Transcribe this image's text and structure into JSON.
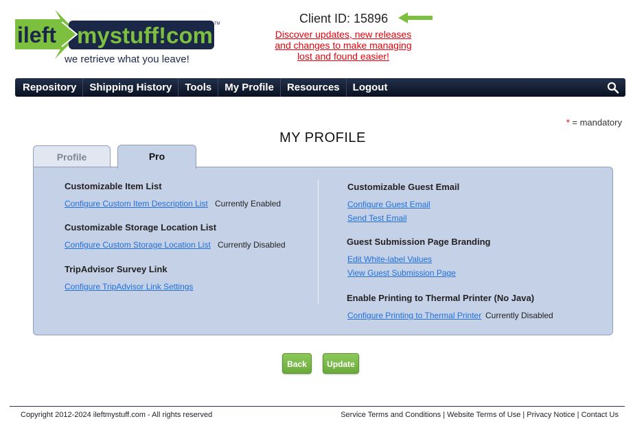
{
  "brand": {
    "name_part1": "ileft",
    "name_part2": "mystuff!com",
    "tagline": "we retrieve what you leave!",
    "tm": "TM",
    "colors": {
      "green": "#7dbf3f",
      "navy": "#1b2747",
      "accent_red": "#e8000b",
      "link_blue": "#1f6fd8"
    }
  },
  "header": {
    "client_id": "Client ID: 15896",
    "promo_line1": "Discover updates, new releases",
    "promo_line2": "and changes to make managing",
    "promo_line3": "lost and found easier!"
  },
  "nav": {
    "items": [
      {
        "label": "Repository"
      },
      {
        "label": "Shipping History"
      },
      {
        "label": "Tools"
      },
      {
        "label": "My Profile"
      },
      {
        "label": "Resources"
      },
      {
        "label": "Logout"
      }
    ],
    "search_icon": "search-icon"
  },
  "mandatory": {
    "star": "*",
    "text": " = mandatory"
  },
  "page_title": "MY PROFILE",
  "tabs": [
    {
      "label": "Profile",
      "active": false
    },
    {
      "label": "Pro",
      "active": true
    }
  ],
  "left_col": {
    "item_list": {
      "heading": "Customizable Item List",
      "link": "Configure Custom Item Description List",
      "status": "Currently Enabled"
    },
    "storage_list": {
      "heading": "Customizable Storage Location List",
      "link": "Configure Custom Storage Location List",
      "status": "Currently Disabled"
    },
    "tripadvisor": {
      "heading": "TripAdvisor Survey Link",
      "link": "Configure TripAdvisor Link Settings"
    }
  },
  "right_col": {
    "guest_email": {
      "heading": "Customizable Guest Email",
      "link1": "Configure Guest Email",
      "link2": "Send Test Email"
    },
    "branding": {
      "heading": "Guest Submission Page Branding",
      "link1": "Edit White-label Values",
      "link2": "View Guest Submission Page"
    },
    "printing": {
      "heading": "Enable Printing to Thermal Printer (No Java)",
      "link": "Configure Printing to Thermal Printer",
      "status": "Currently Disabled"
    }
  },
  "buttons": {
    "back": "Back",
    "update": "Update"
  },
  "footer": {
    "copyright": "Copyright 2012-2024 ileftmystuff.com - All rights reserved",
    "links": [
      "Service Terms and Conditions",
      "Website Terms of Use",
      "Privacy Notice",
      "Contact Us"
    ],
    "separator": " | "
  }
}
